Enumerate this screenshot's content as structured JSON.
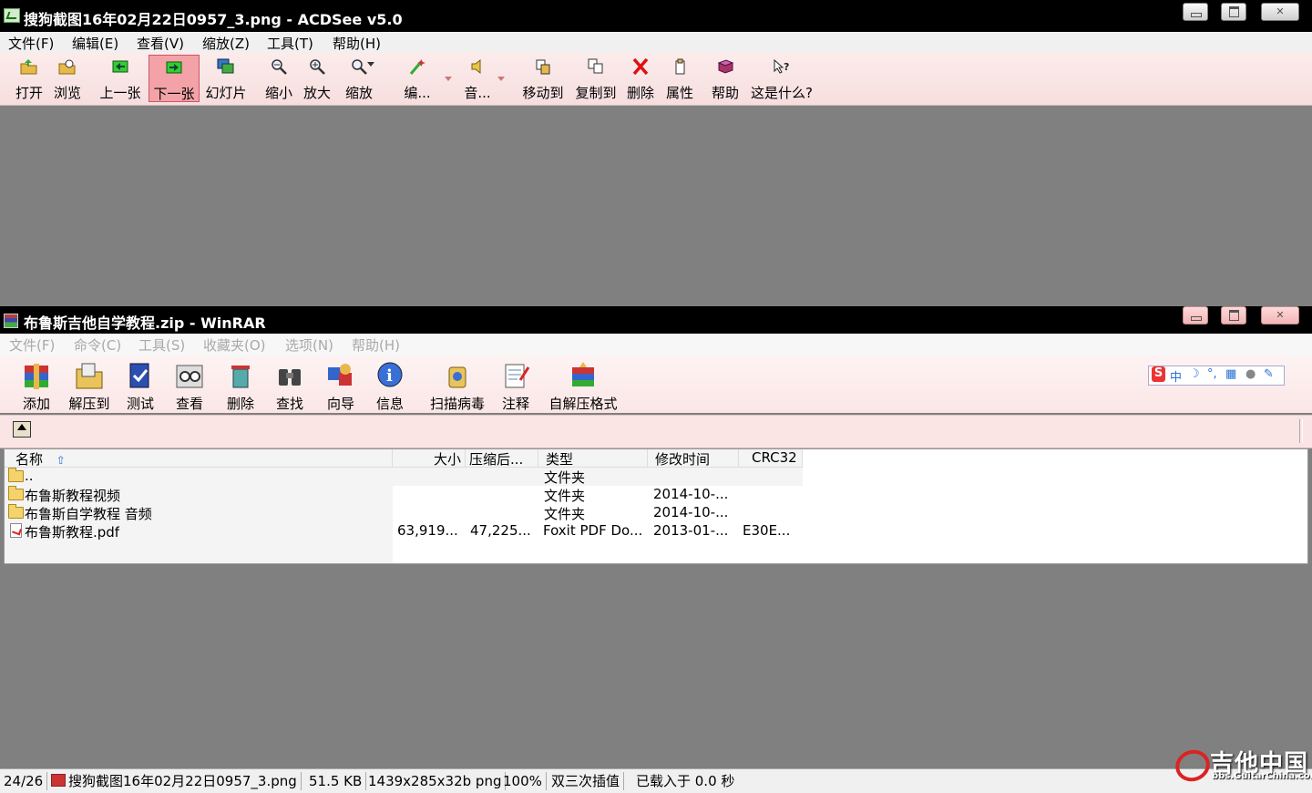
{
  "acdsee": {
    "title": "搜狗截图16年02月22日0957_3.png - ACDSee v5.0",
    "menu": [
      "文件(F)",
      "编辑(E)",
      "查看(V)",
      "缩放(Z)",
      "工具(T)",
      "帮助(H)"
    ],
    "toolbar": [
      {
        "label": "打开",
        "icon": "folder-open-icon"
      },
      {
        "label": "浏览",
        "icon": "browse-icon"
      },
      {
        "label": "上一张",
        "icon": "prev-arrow-icon"
      },
      {
        "label": "下一张",
        "icon": "next-arrow-icon",
        "active": true
      },
      {
        "label": "幻灯片",
        "icon": "slideshow-icon"
      },
      {
        "label": "缩小",
        "icon": "zoom-out-icon"
      },
      {
        "label": "放大",
        "icon": "zoom-in-icon"
      },
      {
        "label": "缩放",
        "icon": "zoom-icon"
      },
      {
        "label": "编...",
        "icon": "edit-wand-icon"
      },
      {
        "label": "音...",
        "icon": "audio-icon"
      },
      {
        "label": "移动到",
        "icon": "move-to-icon"
      },
      {
        "label": "复制到",
        "icon": "copy-to-icon"
      },
      {
        "label": "删除",
        "icon": "delete-x-icon"
      },
      {
        "label": "属性",
        "icon": "properties-icon"
      },
      {
        "label": "帮助",
        "icon": "help-book-icon"
      },
      {
        "label": "这是什么?",
        "icon": "whats-this-icon"
      }
    ]
  },
  "winrar": {
    "title": "布鲁斯吉他自学教程.zip - WinRAR",
    "menu": [
      "文件(F)",
      "命令(C)",
      "工具(S)",
      "收藏夹(O)",
      "选项(N)",
      "帮助(H)"
    ],
    "toolbar": [
      {
        "label": "添加",
        "icon": "add-archive-icon"
      },
      {
        "label": "解压到",
        "icon": "extract-to-icon"
      },
      {
        "label": "测试",
        "icon": "test-icon"
      },
      {
        "label": "查看",
        "icon": "view-icon"
      },
      {
        "label": "删除",
        "icon": "delete-icon"
      },
      {
        "label": "查找",
        "icon": "find-binoculars-icon"
      },
      {
        "label": "向导",
        "icon": "wizard-icon"
      },
      {
        "label": "信息",
        "icon": "info-icon"
      },
      {
        "label": "扫描病毒",
        "icon": "virus-scan-icon"
      },
      {
        "label": "注释",
        "icon": "comment-icon"
      },
      {
        "label": "自解压格式",
        "icon": "sfx-icon"
      }
    ],
    "ime": {
      "logo": "S",
      "mode": "中"
    },
    "columns": {
      "name": "名称",
      "size": "大小",
      "packed": "压缩后...",
      "type": "类型",
      "modified": "修改时间",
      "crc": "CRC32"
    },
    "rows": [
      {
        "name": "..",
        "size": "",
        "packed": "",
        "type": "文件夹",
        "modified": "",
        "crc": "",
        "icon": "folder"
      },
      {
        "name": "布鲁斯教程视频",
        "size": "",
        "packed": "",
        "type": "文件夹",
        "modified": "2014-10-...",
        "crc": "",
        "icon": "folder"
      },
      {
        "name": "布鲁斯自学教程 音频",
        "size": "",
        "packed": "",
        "type": "文件夹",
        "modified": "2014-10-...",
        "crc": "",
        "icon": "folder"
      },
      {
        "name": "布鲁斯教程.pdf",
        "size": "63,919...",
        "packed": "47,225...",
        "type": "Foxit PDF Do...",
        "modified": "2013-01-...",
        "crc": "E30E...",
        "icon": "pdf"
      }
    ]
  },
  "status": {
    "index": "24/26",
    "file": "搜狗截图16年02月22日0957_3.png",
    "size": "51.5 KB",
    "dims": "1439x285x32b png",
    "zoom": "100%",
    "filter": "双三次插值",
    "loaded": "已载入于 0.0 秒"
  },
  "watermark": {
    "main": "吉他中国",
    "sub": "bbs.GuitarChina.com"
  }
}
